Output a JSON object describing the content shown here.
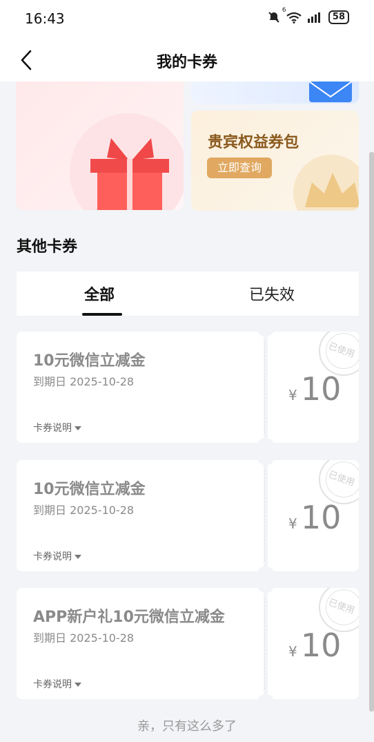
{
  "status_bar": {
    "time": "16:43",
    "wifi_badge": "6",
    "battery": "58"
  },
  "header": {
    "title": "我的卡券"
  },
  "banners": {
    "vip_title": "贵宾权益券包",
    "vip_button": "立即查询"
  },
  "section": {
    "title": "其他卡券"
  },
  "tabs": [
    {
      "label": "全部",
      "active": true
    },
    {
      "label": "已失效",
      "active": false
    }
  ],
  "coupons": [
    {
      "name": "10元微信立减金",
      "expire": "到期日 2025-10-28",
      "explain": "卡券说明",
      "currency": "¥",
      "amount": "10",
      "stamp": "已使用"
    },
    {
      "name": "10元微信立减金",
      "expire": "到期日 2025-10-28",
      "explain": "卡券说明",
      "currency": "¥",
      "amount": "10",
      "stamp": "已使用"
    },
    {
      "name": "APP新户礼10元微信立减金",
      "expire": "到期日 2025-10-28",
      "explain": "卡券说明",
      "currency": "¥",
      "amount": "10",
      "stamp": "已使用"
    }
  ],
  "footer": {
    "text": "亲，只有这么多了"
  },
  "colors": {
    "accent_gold": "#e0a860",
    "envelope_blue": "#3c86f5",
    "gift_red": "#f24b4b",
    "page_bg": "#f2f4f7"
  }
}
